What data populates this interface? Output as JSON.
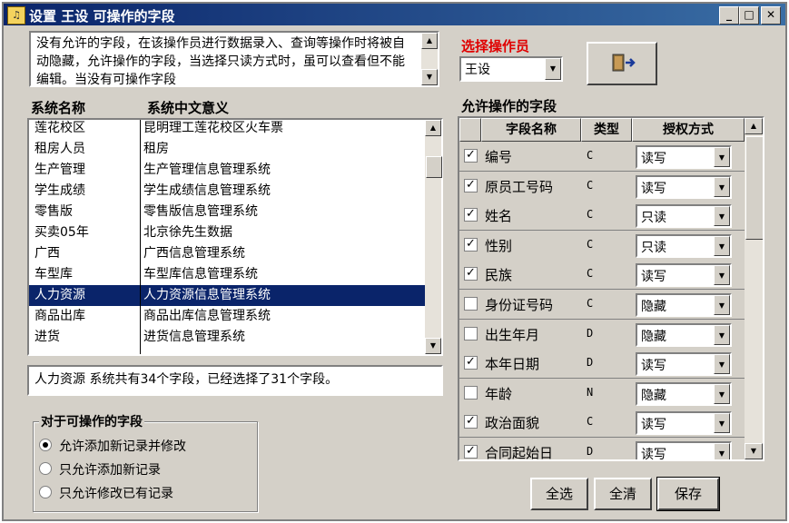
{
  "window": {
    "title": "设置 王设 可操作的字段",
    "app_icon": "app-icon",
    "controls": [
      "minimize-icon",
      "maximize-icon",
      "close-icon"
    ]
  },
  "description": "没有允许的字段，在该操作员进行数据录入、查询等操作时将被自动隐藏，允许操作的字段，当选择只读方式时，虽可以查看但不能编辑。当没有可操作字段",
  "system_list": {
    "headers": [
      "系统名称",
      "系统中文意义"
    ],
    "rows": [
      {
        "name": "莲花校区",
        "desc": "昆明理工莲花校区火车票"
      },
      {
        "name": "租房人员",
        "desc": "租房"
      },
      {
        "name": "生产管理",
        "desc": "生产管理信息管理系统"
      },
      {
        "name": "学生成绩",
        "desc": "学生成绩信息管理系统"
      },
      {
        "name": "零售版",
        "desc": "零售版信息管理系统"
      },
      {
        "name": "买卖05年",
        "desc": "北京徐先生数据"
      },
      {
        "name": "广西",
        "desc": "广西信息管理系统"
      },
      {
        "name": "车型库",
        "desc": "车型库信息管理系统"
      },
      {
        "name": "人力资源",
        "desc": "人力资源信息管理系统",
        "selected": true
      },
      {
        "name": "商品出库",
        "desc": "商品出库信息管理系统"
      },
      {
        "name": "进货",
        "desc": "进货信息管理系统"
      }
    ]
  },
  "status_text": "人力资源 系统共有34个字段，已经选择了31个字段。",
  "edit_options": {
    "title": "对于可操作的字段",
    "options": [
      {
        "label": "允许添加新记录并修改",
        "checked": true
      },
      {
        "label": "只允许添加新记录",
        "checked": false
      },
      {
        "label": "只允许修改已有记录",
        "checked": false
      }
    ]
  },
  "operator": {
    "label": "选择操作员",
    "value": "王设",
    "exit_icon": "exit-door-icon"
  },
  "fields": {
    "title": "允许操作的字段",
    "headers": [
      "字段名称",
      "类型",
      "授权方式"
    ],
    "rows": [
      {
        "checked": true,
        "name": "编号",
        "type": "C",
        "auth": "读写"
      },
      {
        "checked": true,
        "name": "原员工号码",
        "type": "C",
        "auth": "读写"
      },
      {
        "checked": true,
        "name": "姓名",
        "type": "C",
        "auth": "只读"
      },
      {
        "checked": true,
        "name": "性别",
        "type": "C",
        "auth": "只读"
      },
      {
        "checked": true,
        "name": "民族",
        "type": "C",
        "auth": "读写"
      },
      {
        "checked": false,
        "name": "身份证号码",
        "type": "C",
        "auth": "隐藏"
      },
      {
        "checked": false,
        "name": "出生年月",
        "type": "D",
        "auth": "隐藏"
      },
      {
        "checked": true,
        "name": "本年日期",
        "type": "D",
        "auth": "读写"
      },
      {
        "checked": false,
        "name": "年龄",
        "type": "N",
        "auth": "隐藏"
      },
      {
        "checked": true,
        "name": "政治面貌",
        "type": "C",
        "auth": "读写"
      },
      {
        "checked": true,
        "name": "合同起始日",
        "type": "D",
        "auth": "读写"
      }
    ]
  },
  "buttons": {
    "select_all": "全选",
    "clear_all": "全清",
    "save": "保存"
  }
}
